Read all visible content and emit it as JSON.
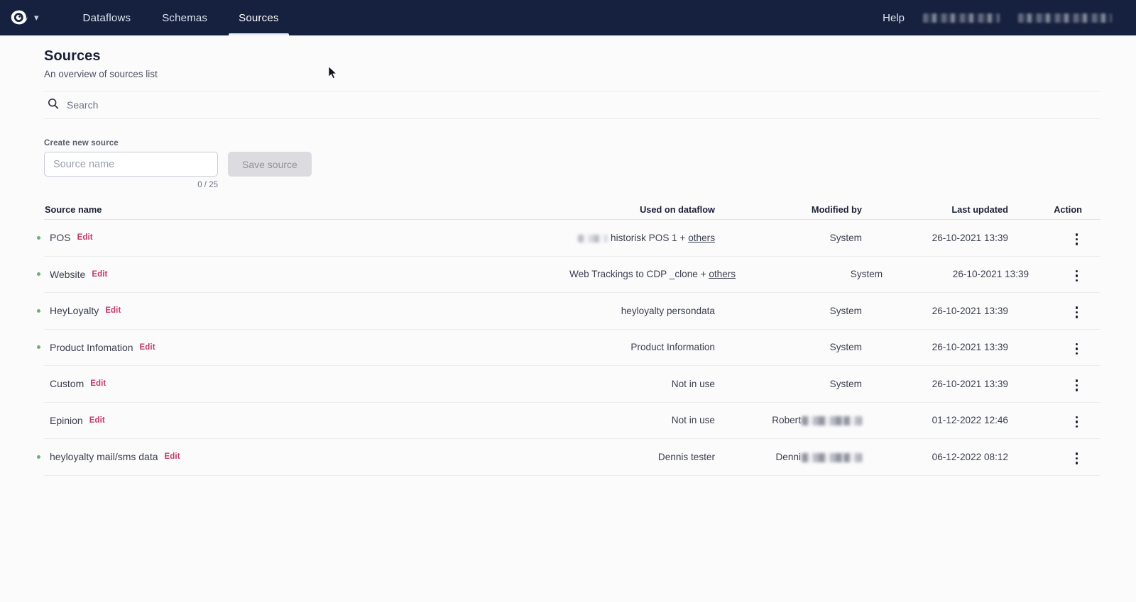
{
  "navbar": {
    "logo_icon": "swirl-eye-logo-icon",
    "logo_caret_icon": "chevron-down-icon",
    "tabs": [
      {
        "label": "Dataflows",
        "active": false
      },
      {
        "label": "Schemas",
        "active": false
      },
      {
        "label": "Sources",
        "active": true
      }
    ],
    "help_label": "Help",
    "account_redacted_1": "",
    "account_redacted_2": ""
  },
  "page": {
    "title": "Sources",
    "subtitle": "An overview of sources list"
  },
  "search": {
    "icon": "search-icon",
    "placeholder": "Search",
    "value": ""
  },
  "create_source": {
    "label": "Create new source",
    "input_placeholder": "Source name",
    "input_value": "",
    "char_count": "0 / 25",
    "save_label": "Save source"
  },
  "table": {
    "columns": [
      "Source name",
      "Used on dataflow",
      "Modified by",
      "Last updated",
      "Action"
    ],
    "edit_label": "Edit",
    "others_label": "others",
    "action_icon": "kebab-menu-icon",
    "rows": [
      {
        "status": "active",
        "name": "POS",
        "dataflow_prefix_redacted": true,
        "dataflow": "historisk POS 1 + ",
        "dataflow_link": "others",
        "modified_by": "System",
        "modified_by_redacted": false,
        "last_updated": "26-10-2021 13:39"
      },
      {
        "status": "active",
        "name": "Website",
        "dataflow_prefix_redacted": false,
        "dataflow": "Web Trackings to CDP _clone + ",
        "dataflow_link": "others",
        "modified_by": "System",
        "modified_by_redacted": false,
        "last_updated": "26-10-2021 13:39"
      },
      {
        "status": "active",
        "name": "HeyLoyalty",
        "dataflow_prefix_redacted": false,
        "dataflow": "heyloyalty persondata",
        "dataflow_link": "",
        "modified_by": "System",
        "modified_by_redacted": false,
        "last_updated": "26-10-2021 13:39"
      },
      {
        "status": "active",
        "name": "Product Infomation",
        "dataflow_prefix_redacted": false,
        "dataflow": "Product Information",
        "dataflow_link": "",
        "modified_by": "System",
        "modified_by_redacted": false,
        "last_updated": "26-10-2021 13:39"
      },
      {
        "status": "inactive",
        "name": "Custom",
        "dataflow_prefix_redacted": false,
        "dataflow": "Not in use",
        "dataflow_link": "",
        "modified_by": "System",
        "modified_by_redacted": false,
        "last_updated": "26-10-2021 13:39"
      },
      {
        "status": "inactive",
        "name": "Epinion",
        "dataflow_prefix_redacted": false,
        "dataflow": "Not in use",
        "dataflow_link": "",
        "modified_by": "Robert",
        "modified_by_redacted": true,
        "last_updated": "01-12-2022 12:46"
      },
      {
        "status": "active",
        "name": "heyloyalty mail/sms data",
        "dataflow_prefix_redacted": false,
        "dataflow": "Dennis tester",
        "dataflow_link": "",
        "modified_by": "Denni",
        "modified_by_redacted": true,
        "last_updated": "06-12-2022 08:12"
      }
    ]
  },
  "colors": {
    "navbar_bg": "#16213f",
    "page_bg": "#fbfbfc",
    "status_dot": "#6ab07c",
    "edit_link": "#c03a6b",
    "title": "#1b2136"
  }
}
